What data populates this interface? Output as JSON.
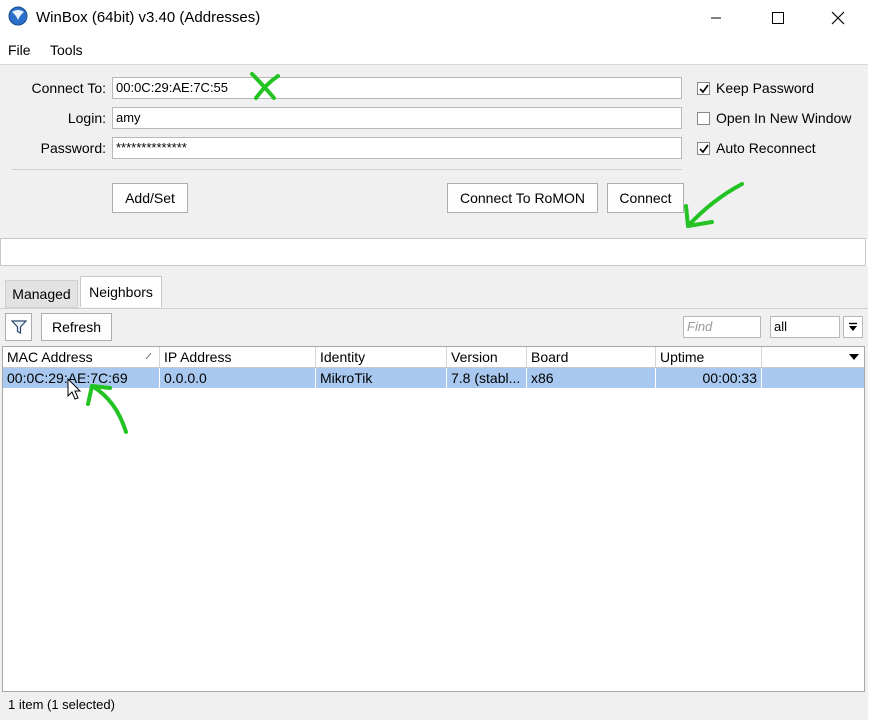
{
  "window": {
    "title": "WinBox (64bit) v3.40 (Addresses)",
    "icons": {
      "app": "winbox-globe-icon",
      "minimize": "minimize-icon",
      "maximize": "maximize-icon",
      "close": "close-icon"
    }
  },
  "menu": {
    "file": "File",
    "tools": "Tools"
  },
  "form": {
    "connect_to_label": "Connect To:",
    "connect_to_value": "00:0C:29:AE:7C:55",
    "login_label": "Login:",
    "login_value": "amy",
    "password_label": "Password:",
    "password_value": "**************",
    "keep_password": {
      "label": "Keep Password",
      "checked": true
    },
    "open_new_window": {
      "label": "Open In New Window",
      "checked": false
    },
    "auto_reconnect": {
      "label": "Auto Reconnect",
      "checked": true
    },
    "add_set_button": "Add/Set",
    "connect_romon_button": "Connect To RoMON",
    "connect_button": "Connect"
  },
  "tabs": {
    "managed": "Managed",
    "neighbors": "Neighbors",
    "active": "Neighbors"
  },
  "toolbar": {
    "filter_icon": "filter-icon",
    "refresh": "Refresh",
    "find_placeholder": "Find",
    "filter_select": "all"
  },
  "table": {
    "columns": [
      "MAC Address",
      "IP Address",
      "Identity",
      "Version",
      "Board",
      "Uptime"
    ],
    "rows": [
      {
        "mac": "00:0C:29:AE:7C:69",
        "ip": "0.0.0.0",
        "identity": "MikroTik",
        "version": "7.8 (stabl...",
        "board": "x86",
        "uptime": "00:00:33",
        "selected": true
      }
    ]
  },
  "status": {
    "text": "1 item (1 selected)"
  },
  "annotation_color": "#22c322"
}
